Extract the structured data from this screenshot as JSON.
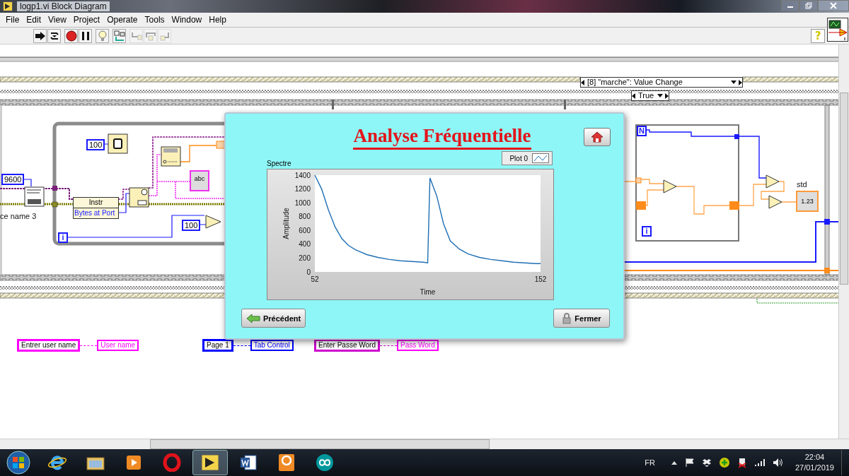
{
  "window": {
    "title": "logp1.vi Block Diagram"
  },
  "menu": [
    "File",
    "Edit",
    "View",
    "Project",
    "Operate",
    "Tools",
    "Window",
    "Help"
  ],
  "help_button": "?",
  "toolbar": [
    {
      "kind": "run",
      "disabled": false
    },
    {
      "kind": "run-continuously",
      "disabled": false
    },
    {
      "kind": "abort",
      "disabled": false
    },
    {
      "kind": "pause",
      "disabled": false
    },
    {
      "kind": "highlight",
      "disabled": false
    },
    {
      "kind": "retain",
      "disabled": false
    },
    {
      "kind": "step-into",
      "disabled": true
    },
    {
      "kind": "step-over",
      "disabled": true
    },
    {
      "kind": "step-out",
      "disabled": true
    }
  ],
  "diagram": {
    "event_selector": "[8] \"marche\": Value Change",
    "case_selector": "True",
    "baud_constant": "9600",
    "resource_label": "ce name 3",
    "wait_constant": "100",
    "property_node": {
      "class": "Instr",
      "property": "Bytes at Port"
    },
    "string_indicator": "abc",
    "compare_constant": "100",
    "while_iteration": "i",
    "for_count": "N",
    "for_iteration": "i",
    "std_indicator": {
      "label": "std",
      "value": "1.23"
    }
  },
  "terminal_pairs": [
    {
      "source": {
        "label": "Entrer user name",
        "color": "#ff00ff"
      },
      "target": {
        "label": "User name",
        "color": "#ff00ff"
      }
    },
    {
      "source": {
        "label": "Page 1",
        "color": "#0000ff"
      },
      "target": {
        "label": "Tab Control",
        "color": "#0000ff"
      }
    },
    {
      "source": {
        "label": "Enter Passe Word",
        "color": "#cc00cc"
      },
      "target": {
        "label": "Pass Word",
        "color": "#ff00ff"
      }
    }
  ],
  "dialog": {
    "title": "Analyse Fréquentielle",
    "graph": {
      "label": "Spectre",
      "chart_data": {
        "type": "line",
        "xlabel": "Time",
        "ylabel": "Amplitude",
        "x": [
          52,
          55,
          58,
          61,
          64,
          67,
          70,
          75,
          80,
          85,
          90,
          95,
          100,
          102,
          103,
          106,
          109,
          112,
          116,
          120,
          125,
          130,
          135,
          140,
          145,
          150,
          152
        ],
        "series": [
          {
            "name": "Plot 0",
            "color": "#1f6fb4",
            "values": [
              1400,
              1200,
              900,
              650,
              480,
              380,
              320,
              250,
              210,
              180,
              160,
              150,
              140,
              130,
              1360,
              1100,
              700,
              450,
              330,
              260,
              210,
              180,
              160,
              140,
              130,
              120,
              120
            ]
          }
        ],
        "xlim": [
          52,
          152
        ],
        "ylim": [
          0,
          1400
        ],
        "xticks": [
          52,
          152
        ],
        "yticks": [
          0,
          200,
          400,
          600,
          800,
          1000,
          1200,
          1400
        ]
      }
    },
    "buttons": [
      {
        "kind": "back",
        "label": "Précédent"
      },
      {
        "kind": "close",
        "label": "Fermer"
      }
    ]
  },
  "taskbar": {
    "apps": [
      {
        "kind": "browser",
        "selected": false
      },
      {
        "kind": "folder",
        "selected": false
      },
      {
        "kind": "media",
        "selected": false
      },
      {
        "kind": "opera",
        "selected": false
      },
      {
        "kind": "labview",
        "selected": true
      },
      {
        "kind": "word",
        "selected": false
      },
      {
        "kind": "pdf",
        "selected": false
      },
      {
        "kind": "arduino",
        "selected": false
      }
    ],
    "language": "FR",
    "time": "22:04",
    "date": "27/01/2019"
  }
}
